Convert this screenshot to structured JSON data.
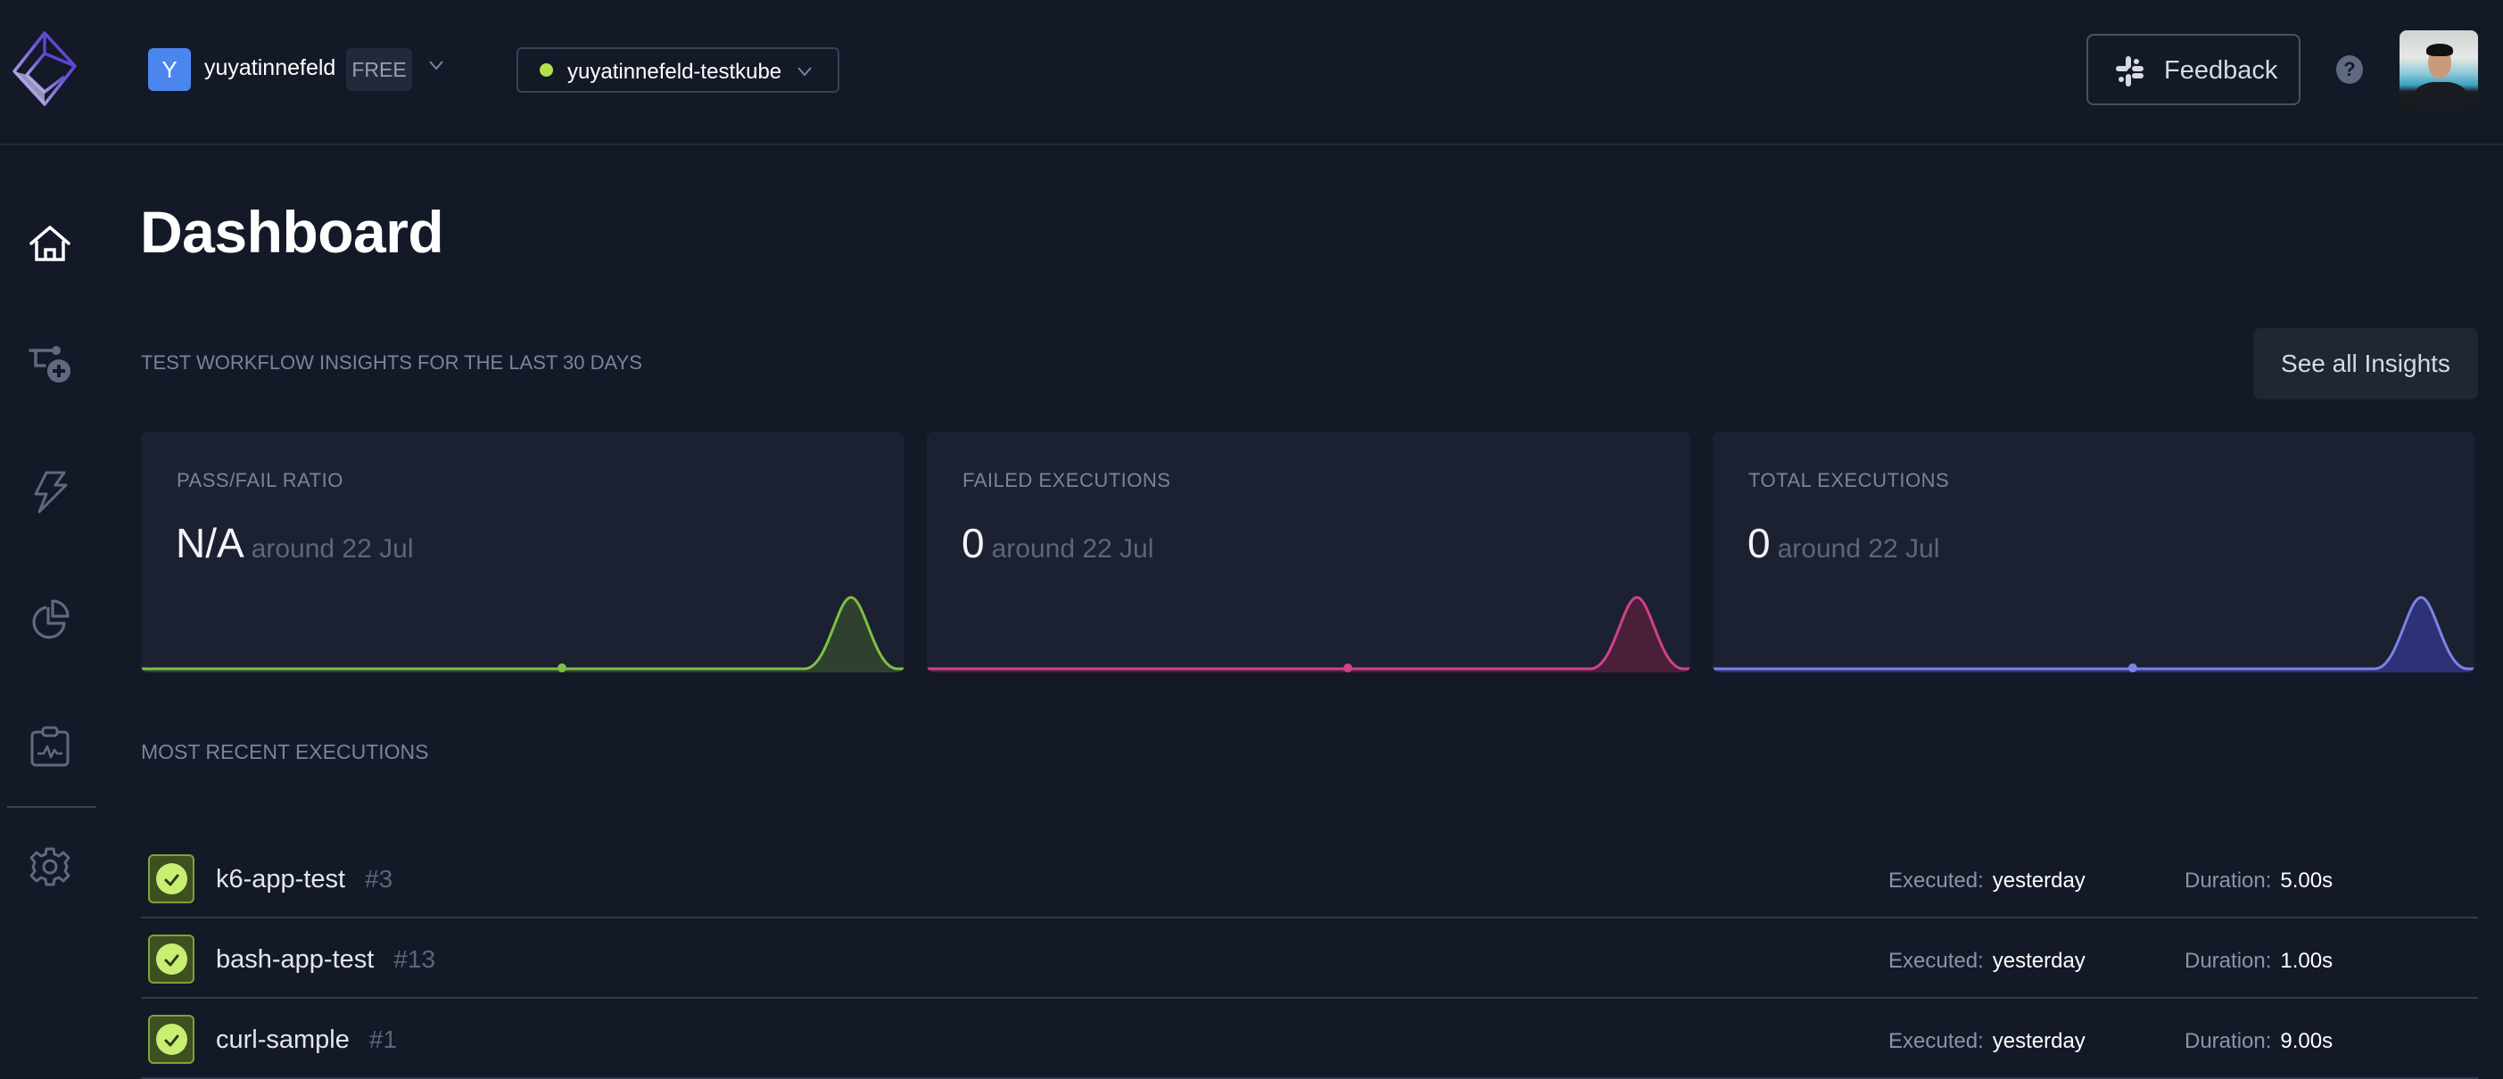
{
  "header": {
    "org": {
      "initial": "Y",
      "name": "yuyatinnefeld",
      "plan": "FREE"
    },
    "environment": {
      "name": "yuyatinnefeld-testkube",
      "status_color": "#b5e04e"
    },
    "feedback_label": "Feedback",
    "help_label": "?"
  },
  "sidebar": {
    "items": [
      {
        "id": "dashboard",
        "icon": "home-icon",
        "active": true
      },
      {
        "id": "test-workflows",
        "icon": "workflow-add-icon",
        "active": false
      },
      {
        "id": "triggers",
        "icon": "lightning-icon",
        "active": false
      },
      {
        "id": "insights",
        "icon": "pie-chart-icon",
        "active": false
      },
      {
        "id": "status-pages",
        "icon": "clipboard-pulse-icon",
        "active": false
      },
      {
        "id": "settings",
        "icon": "gear-icon",
        "active": false
      }
    ]
  },
  "main": {
    "title": "Dashboard",
    "insights_heading": "TEST WORKFLOW INSIGHTS FOR THE LAST 30 DAYS",
    "see_all_label": "See all Insights",
    "cards": [
      {
        "label": "PASS/FAIL RATIO",
        "value": "N/A",
        "sub": "around 22 Jul",
        "color": "#7fbf45",
        "fill": "#2f4030"
      },
      {
        "label": "FAILED EXECUTIONS",
        "value": "0",
        "sub": "around 22 Jul",
        "color": "#d0418a",
        "fill": "#4a2038"
      },
      {
        "label": "TOTAL EXECUTIONS",
        "value": "0",
        "sub": "around 22 Jul",
        "color": "#7b83e8",
        "fill": "#2e3176"
      }
    ],
    "recent_heading": "MOST RECENT EXECUTIONS",
    "executed_label": "Executed:",
    "duration_label": "Duration:",
    "executions": [
      {
        "name": "k6-app-test",
        "number": "#3",
        "executed": "yesterday",
        "duration": "5.00s",
        "status": "passed"
      },
      {
        "name": "bash-app-test",
        "number": "#13",
        "executed": "yesterday",
        "duration": "1.00s",
        "status": "passed"
      },
      {
        "name": "curl-sample",
        "number": "#1",
        "executed": "yesterday",
        "duration": "9.00s",
        "status": "passed"
      }
    ]
  }
}
